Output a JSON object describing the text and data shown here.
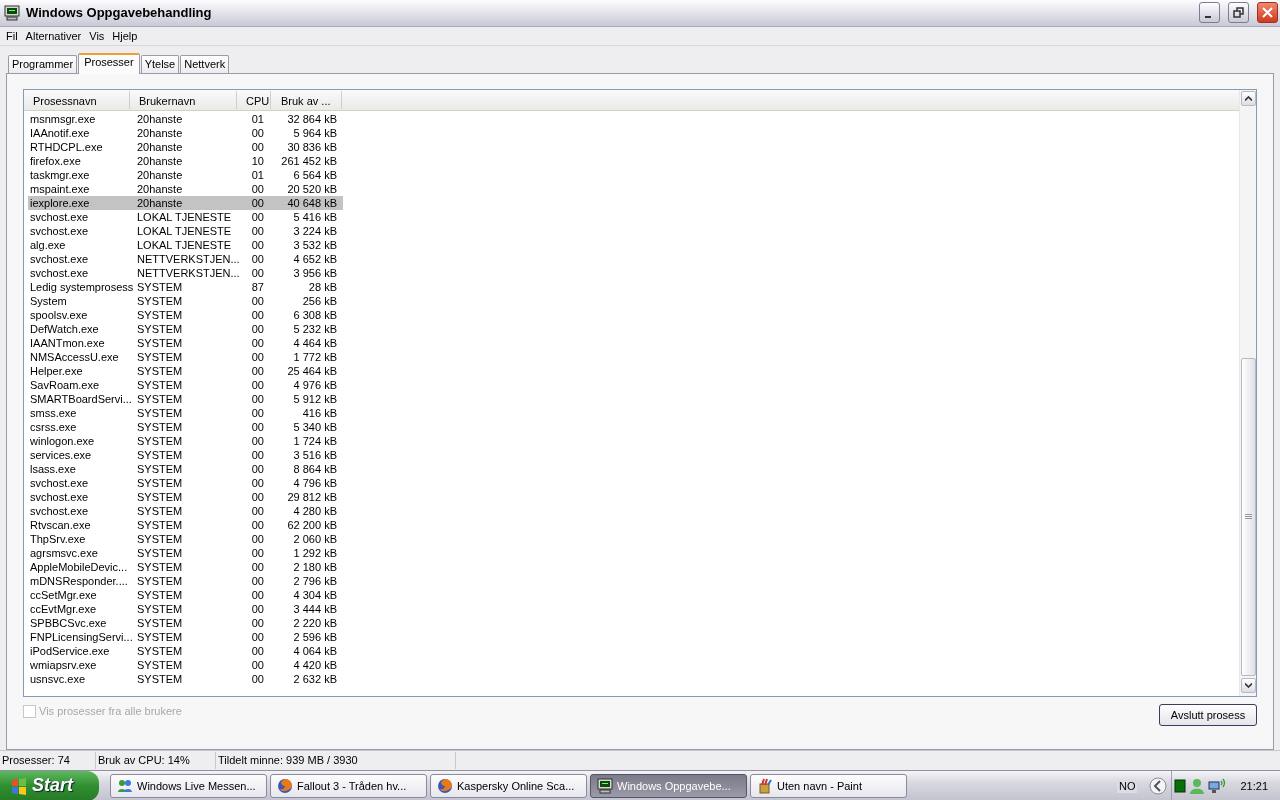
{
  "window": {
    "title": "Windows Oppgavebehandling"
  },
  "menu": [
    "Fil",
    "Alternativer",
    "Vis",
    "Hjelp"
  ],
  "tabs": [
    {
      "label": "Programmer",
      "selected": false
    },
    {
      "label": "Prosesser",
      "selected": true
    },
    {
      "label": "Ytelse",
      "selected": false
    },
    {
      "label": "Nettverk",
      "selected": false
    }
  ],
  "table": {
    "columns": [
      "Prosessnavn",
      "Brukernavn",
      "CPU",
      "Bruk av ..."
    ],
    "rows": [
      {
        "name": "msnmsgr.exe",
        "user": "20hanste",
        "cpu": "01",
        "memory": "32 864 kB",
        "selected": false
      },
      {
        "name": "IAAnotif.exe",
        "user": "20hanste",
        "cpu": "00",
        "memory": "5 964 kB",
        "selected": false
      },
      {
        "name": "RTHDCPL.exe",
        "user": "20hanste",
        "cpu": "00",
        "memory": "30 836 kB",
        "selected": false
      },
      {
        "name": "firefox.exe",
        "user": "20hanste",
        "cpu": "10",
        "memory": "261 452 kB",
        "selected": false
      },
      {
        "name": "taskmgr.exe",
        "user": "20hanste",
        "cpu": "01",
        "memory": "6 564 kB",
        "selected": false
      },
      {
        "name": "mspaint.exe",
        "user": "20hanste",
        "cpu": "00",
        "memory": "20 520 kB",
        "selected": false
      },
      {
        "name": "iexplore.exe",
        "user": "20hanste",
        "cpu": "00",
        "memory": "40 648 kB",
        "selected": true
      },
      {
        "name": "svchost.exe",
        "user": "LOKAL TJENESTE",
        "cpu": "00",
        "memory": "5 416 kB",
        "selected": false
      },
      {
        "name": "svchost.exe",
        "user": "LOKAL TJENESTE",
        "cpu": "00",
        "memory": "3 224 kB",
        "selected": false
      },
      {
        "name": "alg.exe",
        "user": "LOKAL TJENESTE",
        "cpu": "00",
        "memory": "3 532 kB",
        "selected": false
      },
      {
        "name": "svchost.exe",
        "user": "NETTVERKSTJEN...",
        "cpu": "00",
        "memory": "4 652 kB",
        "selected": false
      },
      {
        "name": "svchost.exe",
        "user": "NETTVERKSTJEN...",
        "cpu": "00",
        "memory": "3 956 kB",
        "selected": false
      },
      {
        "name": "Ledig systemprosess",
        "user": "SYSTEM",
        "cpu": "87",
        "memory": "28 kB",
        "selected": false
      },
      {
        "name": "System",
        "user": "SYSTEM",
        "cpu": "00",
        "memory": "256 kB",
        "selected": false
      },
      {
        "name": "spoolsv.exe",
        "user": "SYSTEM",
        "cpu": "00",
        "memory": "6 308 kB",
        "selected": false
      },
      {
        "name": "DefWatch.exe",
        "user": "SYSTEM",
        "cpu": "00",
        "memory": "5 232 kB",
        "selected": false
      },
      {
        "name": "IAANTmon.exe",
        "user": "SYSTEM",
        "cpu": "00",
        "memory": "4 464 kB",
        "selected": false
      },
      {
        "name": "NMSAccessU.exe",
        "user": "SYSTEM",
        "cpu": "00",
        "memory": "1 772 kB",
        "selected": false
      },
      {
        "name": "Helper.exe",
        "user": "SYSTEM",
        "cpu": "00",
        "memory": "25 464 kB",
        "selected": false
      },
      {
        "name": "SavRoam.exe",
        "user": "SYSTEM",
        "cpu": "00",
        "memory": "4 976 kB",
        "selected": false
      },
      {
        "name": "SMARTBoardServi...",
        "user": "SYSTEM",
        "cpu": "00",
        "memory": "5 912 kB",
        "selected": false
      },
      {
        "name": "smss.exe",
        "user": "SYSTEM",
        "cpu": "00",
        "memory": "416 kB",
        "selected": false
      },
      {
        "name": "csrss.exe",
        "user": "SYSTEM",
        "cpu": "00",
        "memory": "5 340 kB",
        "selected": false
      },
      {
        "name": "winlogon.exe",
        "user": "SYSTEM",
        "cpu": "00",
        "memory": "1 724 kB",
        "selected": false
      },
      {
        "name": "services.exe",
        "user": "SYSTEM",
        "cpu": "00",
        "memory": "3 516 kB",
        "selected": false
      },
      {
        "name": "lsass.exe",
        "user": "SYSTEM",
        "cpu": "00",
        "memory": "8 864 kB",
        "selected": false
      },
      {
        "name": "svchost.exe",
        "user": "SYSTEM",
        "cpu": "00",
        "memory": "4 796 kB",
        "selected": false
      },
      {
        "name": "svchost.exe",
        "user": "SYSTEM",
        "cpu": "00",
        "memory": "29 812 kB",
        "selected": false
      },
      {
        "name": "svchost.exe",
        "user": "SYSTEM",
        "cpu": "00",
        "memory": "4 280 kB",
        "selected": false
      },
      {
        "name": "Rtvscan.exe",
        "user": "SYSTEM",
        "cpu": "00",
        "memory": "62 200 kB",
        "selected": false
      },
      {
        "name": "ThpSrv.exe",
        "user": "SYSTEM",
        "cpu": "00",
        "memory": "2 060 kB",
        "selected": false
      },
      {
        "name": "agrsmsvc.exe",
        "user": "SYSTEM",
        "cpu": "00",
        "memory": "1 292 kB",
        "selected": false
      },
      {
        "name": "AppleMobileDevic...",
        "user": "SYSTEM",
        "cpu": "00",
        "memory": "2 180 kB",
        "selected": false
      },
      {
        "name": "mDNSResponder....",
        "user": "SYSTEM",
        "cpu": "00",
        "memory": "2 796 kB",
        "selected": false
      },
      {
        "name": "ccSetMgr.exe",
        "user": "SYSTEM",
        "cpu": "00",
        "memory": "4 304 kB",
        "selected": false
      },
      {
        "name": "ccEvtMgr.exe",
        "user": "SYSTEM",
        "cpu": "00",
        "memory": "3 444 kB",
        "selected": false
      },
      {
        "name": "SPBBCSvc.exe",
        "user": "SYSTEM",
        "cpu": "00",
        "memory": "2 220 kB",
        "selected": false
      },
      {
        "name": "FNPLicensingServi...",
        "user": "SYSTEM",
        "cpu": "00",
        "memory": "2 596 kB",
        "selected": false
      },
      {
        "name": "iPodService.exe",
        "user": "SYSTEM",
        "cpu": "00",
        "memory": "4 064 kB",
        "selected": false
      },
      {
        "name": "wmiapsrv.exe",
        "user": "SYSTEM",
        "cpu": "00",
        "memory": "4 420 kB",
        "selected": false
      },
      {
        "name": "usnsvc.exe",
        "user": "SYSTEM",
        "cpu": "00",
        "memory": "2 632 kB",
        "selected": false
      }
    ]
  },
  "show_all_users": {
    "label": "Vis prosesser fra alle brukere",
    "checked": false,
    "disabled": true
  },
  "end_process_button": "Avslutt prosess",
  "status_bar": [
    "Prosesser: 74",
    "Bruk av CPU: 14%",
    "Tildelt minne: 939 MB / 3930"
  ],
  "taskbar": {
    "start": "Start",
    "tasks": [
      {
        "label": "Windows Live Messen...",
        "selected": false
      },
      {
        "label": "Fallout 3 - Tråden hv...",
        "selected": false
      },
      {
        "label": "Kaspersky Online Sca...",
        "selected": false
      },
      {
        "label": "Windows Oppgavebe...",
        "selected": true
      },
      {
        "label": "Uten navn - Paint",
        "selected": false
      }
    ],
    "language": "NO",
    "clock": "21:21"
  }
}
